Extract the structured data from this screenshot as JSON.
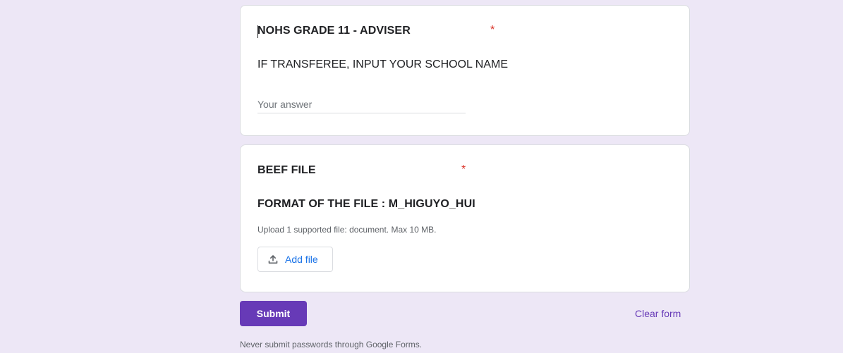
{
  "question1": {
    "title": "NOHS GRADE 11 - ADVISER",
    "required_mark": "*",
    "description": "IF TRANSFEREE, INPUT YOUR SCHOOL NAME",
    "answer_placeholder": "Your answer",
    "answer_value": ""
  },
  "question2": {
    "title": "BEEF FILE",
    "required_mark": "*",
    "description": "FORMAT OF THE FILE : M_HIGUYO_HUI",
    "upload_hint": "Upload 1 supported file: document. Max 10 MB.",
    "add_file_label": "Add file",
    "add_file_icon": "upload-icon"
  },
  "actions": {
    "submit_label": "Submit",
    "clear_label": "Clear form"
  },
  "footer": {
    "text": "Never submit passwords through Google Forms."
  },
  "colors": {
    "background": "#ede7f6",
    "accent": "#673ab7",
    "required": "#d93025",
    "link_blue": "#1a73e8"
  }
}
